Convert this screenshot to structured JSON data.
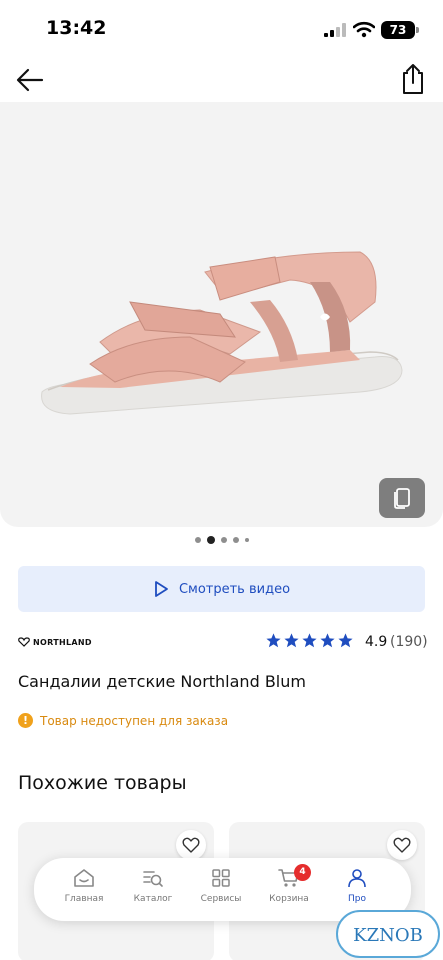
{
  "status_bar": {
    "time": "13:42",
    "battery": "73"
  },
  "product": {
    "gallery": {
      "slide_count": 5,
      "active_slide": 2
    },
    "video_button_label": "Смотреть видео",
    "brand": "NORTHLAND",
    "rating": {
      "value": "4.9",
      "count": "(190)",
      "stars": 5
    },
    "title": "Сандалии детские Northland Blum",
    "availability": "Товар недоступен для заказа"
  },
  "similar": {
    "title": "Похожие товары"
  },
  "tab_bar": {
    "items": [
      {
        "label": "Главная",
        "icon": "home-icon"
      },
      {
        "label": "Каталог",
        "icon": "catalog-search-icon"
      },
      {
        "label": "Сервисы",
        "icon": "services-grid-icon"
      },
      {
        "label": "Корзина",
        "icon": "cart-icon",
        "badge": "4"
      },
      {
        "label": "Про",
        "icon": "profile-icon",
        "active": true
      }
    ]
  },
  "watermark": "KZNOB",
  "colors": {
    "accent": "#1f4dbf",
    "star": "#1f4dbf",
    "warning": "#f0a11b",
    "badge": "#e52d2d"
  }
}
